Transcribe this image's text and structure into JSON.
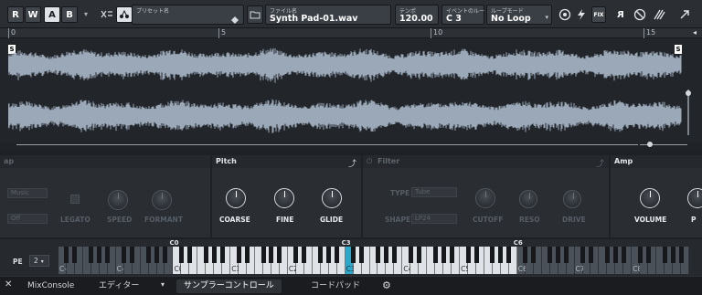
{
  "toolbar": {
    "read_btn": "R",
    "write_btn": "W",
    "a_btn": "A",
    "b_btn": "B",
    "preset_label": "プリセット名",
    "file_label": "ファイル名",
    "file_name": "Synth Pad-01.wav",
    "tempo_label": "テンポ",
    "tempo_value": "120.00",
    "event_root_label": "イベントのルート",
    "event_root_value": "C  3",
    "loop_mode_label": "ループモード",
    "loop_mode_value": "No Loop",
    "fix_btn": "FIX",
    "r_btn": "R"
  },
  "ruler": {
    "ticks": [
      "0",
      "5",
      "10",
      "15"
    ]
  },
  "waveform": {
    "start_marker": "S",
    "end_marker": "S"
  },
  "panels": {
    "left": {
      "title": "ap",
      "music_select": "Music",
      "off_select": "Off",
      "legato": "LEGATO",
      "speed": "SPEED",
      "formant": "FORMANT"
    },
    "pitch": {
      "title": "Pitch",
      "coarse": "COARSE",
      "fine": "FINE",
      "glide": "GLIDE"
    },
    "filter": {
      "title": "Filter",
      "type_label": "TYPE",
      "type_value": "Tube",
      "shape_label": "SHAPE",
      "shape_value": "LP24",
      "cutoff": "CUTOFF",
      "reso": "RESO",
      "drive": "DRIVE"
    },
    "amp": {
      "title": "Amp",
      "volume": "VOLUME",
      "cut_label": "P"
    }
  },
  "keyboard": {
    "pe_label": "PE",
    "pe_value": "2",
    "range_labels": [
      "C0",
      "C3",
      "C6"
    ],
    "octave_labels": [
      "C-2",
      "C-1",
      "C0",
      "C1",
      "C2",
      "C3",
      "C4",
      "C5",
      "C6",
      "C7",
      "C8"
    ]
  },
  "bottom": {
    "mixconsole": "MixConsole",
    "editor": "エディター",
    "sampler": "サンプラーコントロール",
    "chordpad": "コードパッド"
  },
  "colors": {
    "accent": "#2aa7c9",
    "waveform": "#9aa8b8",
    "background": "#1d2024"
  }
}
